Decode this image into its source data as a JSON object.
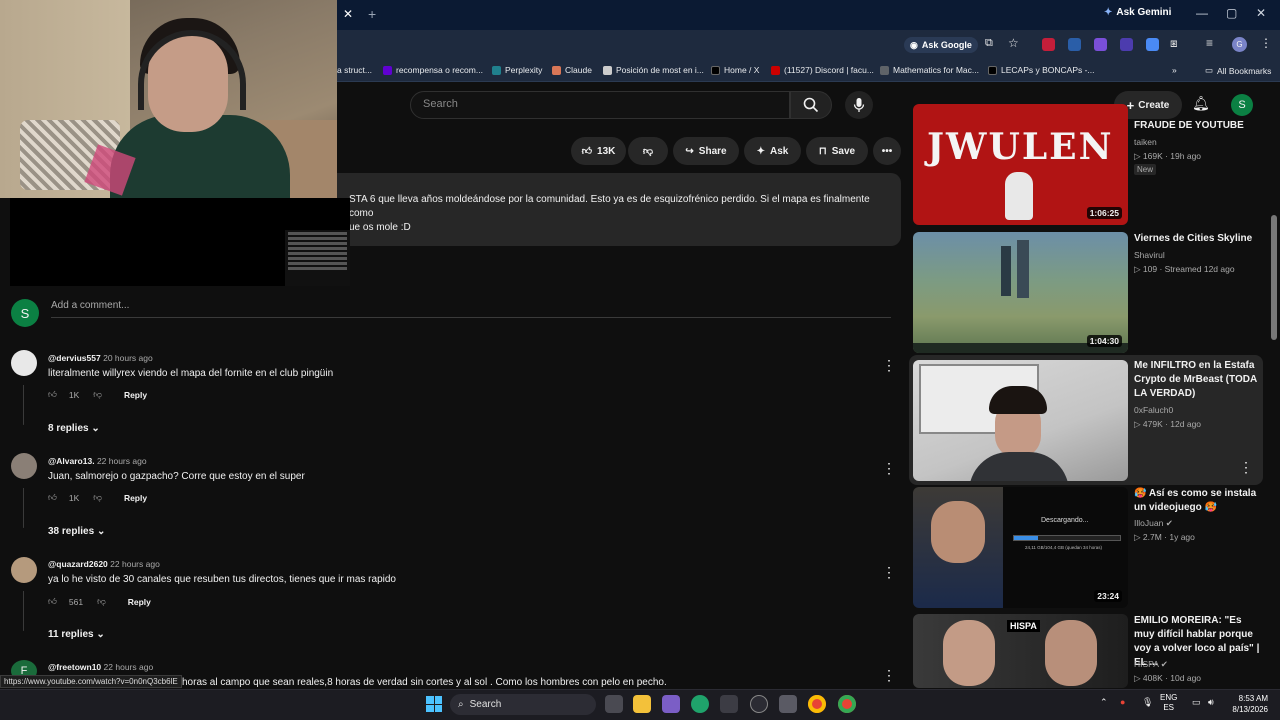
{
  "browser": {
    "gemini_label": "Ask Gemini",
    "ask_google_label": "Ask Google",
    "all_bookmarks_label": "All Bookmarks",
    "bookmarks": [
      {
        "label": "a struct...",
        "color": "#888888"
      },
      {
        "label": "recompensa o recom...",
        "color": "#6001d2"
      },
      {
        "label": "Perplexity",
        "color": "#20808d"
      },
      {
        "label": "Claude",
        "color": "#d97757"
      },
      {
        "label": "Posición de most en i...",
        "color": "#cccccc"
      },
      {
        "label": "Home / X",
        "color": "#000000"
      },
      {
        "label": "(11527) Discord | facu...",
        "color": "#cc0000"
      },
      {
        "label": "Mathematics for Mac...",
        "color": "#5f6368"
      },
      {
        "label": "LECAPs y BONCAPs -...",
        "color": "#000000"
      }
    ]
  },
  "youtube": {
    "search_placeholder": "Search",
    "create_label": "Create",
    "avatar_letter": "S",
    "actions": {
      "likes": "13K",
      "share": "Share",
      "ask": "Ask",
      "save": "Save"
    },
    "description": {
      "line1": "STA 6 que lleva años moldeándose por la comunidad. Esto ya es de esquizofrénico perdido. Si el mapa es finalmente como",
      "line2": "ue os mole :D"
    },
    "add_comment_placeholder": "Add a comment...",
    "comments": [
      {
        "author": "@dervius557",
        "time": "20 hours ago",
        "text": "literalmente willyrex viendo el mapa del fornite en el club pingüin",
        "likes": "1K",
        "reply": "Reply",
        "replies": "8 replies",
        "avatar_color": "#e8e8e8"
      },
      {
        "author": "@Alvaro13.",
        "time": "22 hours ago",
        "text": "Juan, salmorejo o gazpacho? Corre que estoy en el super",
        "likes": "1K",
        "reply": "Reply",
        "replies": "38 replies",
        "avatar_color": "#8a7f76"
      },
      {
        "author": "@quazard2620",
        "time": "22 hours ago",
        "text": "ya lo he visto de 30 canales que resuben tus directos, tienes que ir mas rapido",
        "likes": "561",
        "reply": "Reply",
        "replies": "11 replies",
        "avatar_color": "#b59a7d"
      },
      {
        "author": "@freetown10",
        "time": "22 hours ago",
        "text": "horas al campo que sean reales,8 horas de verdad sin cortes y al sol . Como los hombres con pelo en pecho.",
        "avatar_letter": "F",
        "avatar_color": "#1a6b3b"
      }
    ],
    "sidebar": [
      {
        "title": "FRAUDE DE YOUTUBE",
        "channel": "taiken",
        "meta": "169K · 19h ago",
        "badge": "New",
        "duration": "1:06:25",
        "thumb_text": "JWULEN"
      },
      {
        "title": "Viernes de Cities Skyline",
        "channel": "Shavirul",
        "meta": "109 · Streamed 12d ago",
        "duration": "1:04:30"
      },
      {
        "title": "Me INFILTRO en la Estafa Crypto de MrBeast (TODA LA VERDAD)",
        "channel": "0xFaluch0",
        "meta": "479K · 12d ago"
      },
      {
        "title": "🥵 Así es como se instala un videojuego 🥵",
        "channel": "IlloJuan",
        "meta": "2.7M · 1y ago",
        "duration": "23:24",
        "thumb_text": "Descargando...",
        "thumb_subtext": "24,11 GB/104,4 GB (quedan 34 horas)"
      },
      {
        "title": "EMILIO MOREIRA: \"Es muy difícil hablar porque voy a volver loco al país\" | EL ...",
        "channel": "HISPA",
        "meta": "408K · 10d ago",
        "thumb_text": "HISPA"
      }
    ]
  },
  "status_url": "https://www.youtube.com/watch?v=0n0nQ3cb6lE",
  "taskbar": {
    "search_label": "Search",
    "lang1": "ENG",
    "lang2": "ES",
    "time": "8:53 AM",
    "date": "8/13/2026"
  }
}
